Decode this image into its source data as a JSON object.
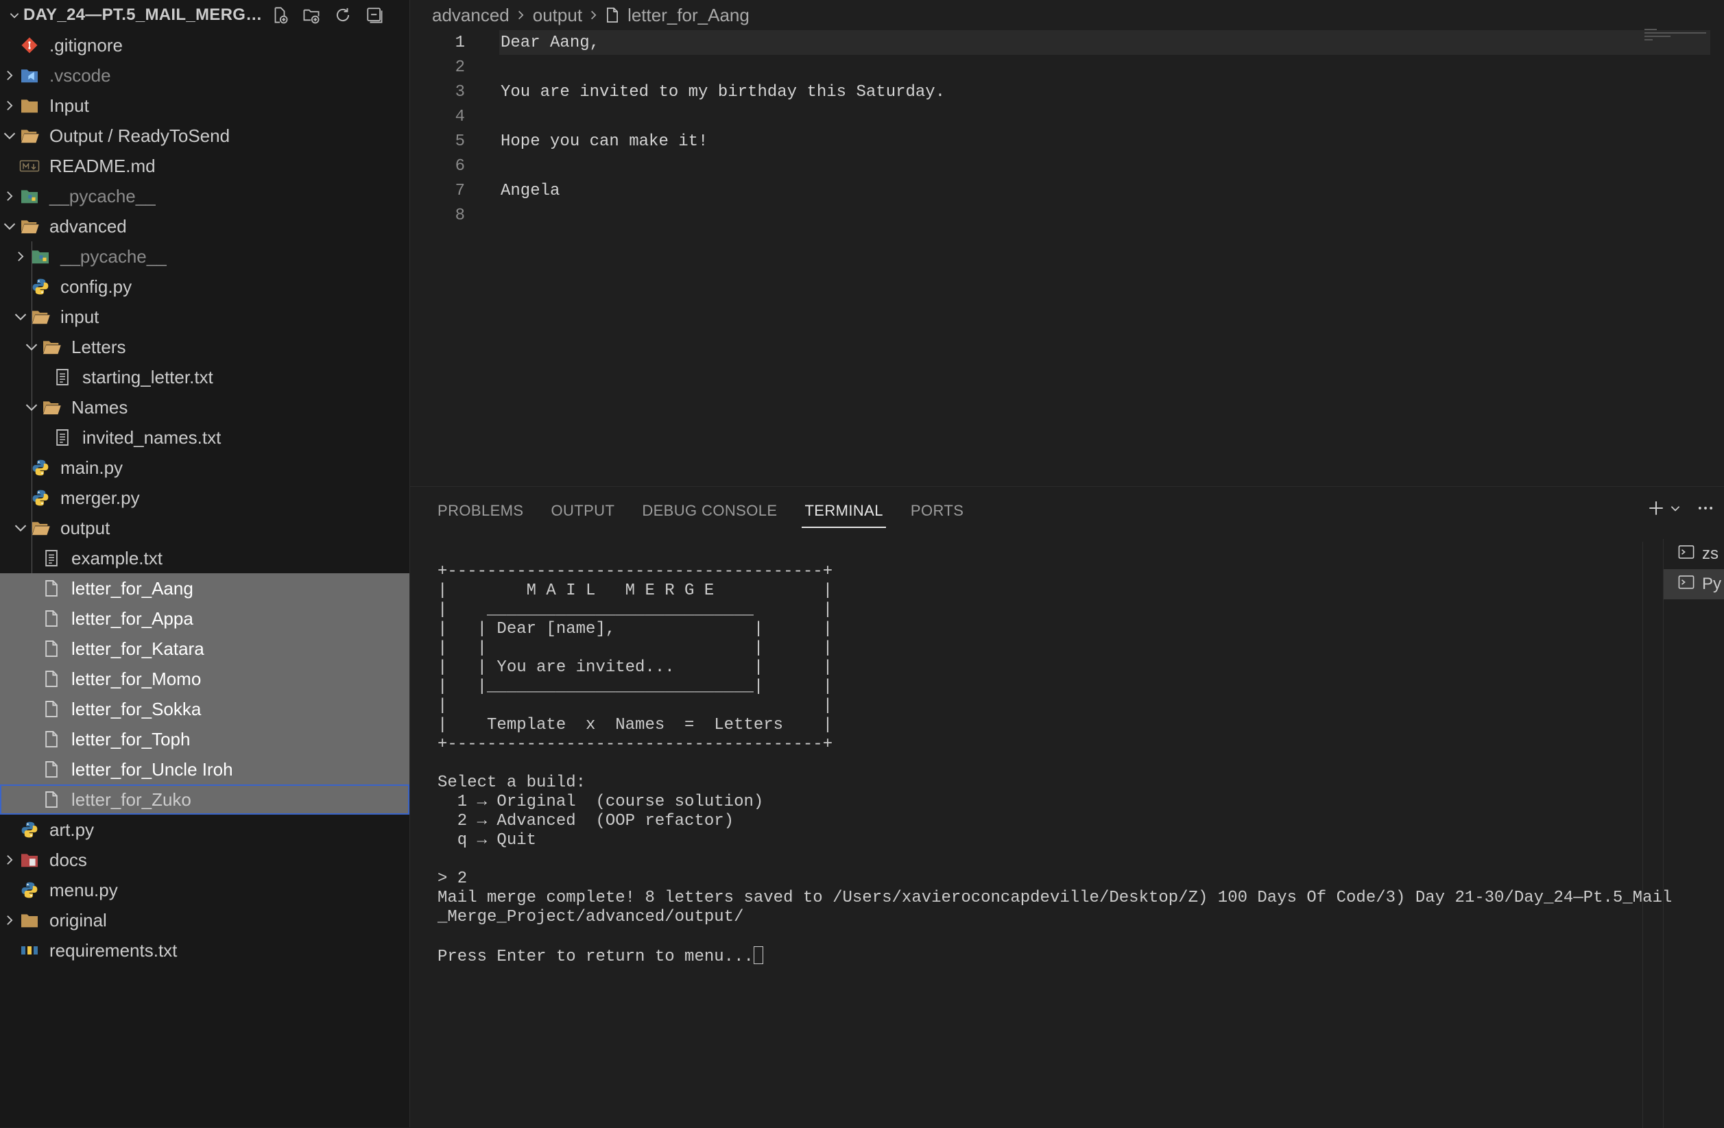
{
  "explorer": {
    "title": "DAY_24—PT.5_MAIL_MERGE...",
    "items": [
      {
        "label": ".gitignore",
        "icon": "git-icon",
        "depth": 0,
        "twistie": "",
        "dim": false,
        "state": ""
      },
      {
        "label": ".vscode",
        "icon": "vscode-folder-icon",
        "depth": 0,
        "twistie": "closed",
        "dim": true,
        "state": ""
      },
      {
        "label": "Input",
        "icon": "folder-icon",
        "depth": 0,
        "twistie": "closed",
        "dim": false,
        "state": ""
      },
      {
        "label": "Output / ReadyToSend",
        "icon": "folder-open-icon",
        "depth": 0,
        "twistie": "open",
        "dim": false,
        "state": ""
      },
      {
        "label": "README.md",
        "icon": "markdown-icon",
        "depth": 0,
        "twistie": "",
        "dim": false,
        "state": ""
      },
      {
        "label": "__pycache__",
        "icon": "python-folder-icon",
        "depth": 0,
        "twistie": "closed",
        "dim": true,
        "state": ""
      },
      {
        "label": "advanced",
        "icon": "folder-open-icon",
        "depth": 0,
        "twistie": "open",
        "dim": false,
        "state": ""
      },
      {
        "label": "__pycache__",
        "icon": "python-folder-icon",
        "depth": 1,
        "twistie": "closed",
        "dim": true,
        "state": ""
      },
      {
        "label": "config.py",
        "icon": "python-icon",
        "depth": 1,
        "twistie": "",
        "dim": false,
        "state": ""
      },
      {
        "label": "input",
        "icon": "folder-open-icon",
        "depth": 1,
        "twistie": "open",
        "dim": false,
        "state": ""
      },
      {
        "label": "Letters",
        "icon": "folder-open-icon",
        "depth": 2,
        "twistie": "open",
        "dim": false,
        "state": ""
      },
      {
        "label": "starting_letter.txt",
        "icon": "text-file-icon",
        "depth": 3,
        "twistie": "",
        "dim": false,
        "state": ""
      },
      {
        "label": "Names",
        "icon": "folder-open-icon",
        "depth": 2,
        "twistie": "open",
        "dim": false,
        "state": ""
      },
      {
        "label": "invited_names.txt",
        "icon": "text-file-icon",
        "depth": 3,
        "twistie": "",
        "dim": false,
        "state": ""
      },
      {
        "label": "main.py",
        "icon": "python-icon",
        "depth": 1,
        "twistie": "",
        "dim": false,
        "state": ""
      },
      {
        "label": "merger.py",
        "icon": "python-icon",
        "depth": 1,
        "twistie": "",
        "dim": false,
        "state": ""
      },
      {
        "label": "output",
        "icon": "folder-open-icon",
        "depth": 1,
        "twistie": "open",
        "dim": false,
        "state": ""
      },
      {
        "label": "example.txt",
        "icon": "text-file-icon",
        "depth": 2,
        "twistie": "",
        "dim": false,
        "state": ""
      },
      {
        "label": "letter_for_Aang",
        "icon": "file-icon",
        "depth": 2,
        "twistie": "",
        "dim": false,
        "state": "selected"
      },
      {
        "label": "letter_for_Appa",
        "icon": "file-icon",
        "depth": 2,
        "twistie": "",
        "dim": false,
        "state": "selected"
      },
      {
        "label": "letter_for_Katara",
        "icon": "file-icon",
        "depth": 2,
        "twistie": "",
        "dim": false,
        "state": "selected"
      },
      {
        "label": "letter_for_Momo",
        "icon": "file-icon",
        "depth": 2,
        "twistie": "",
        "dim": false,
        "state": "selected"
      },
      {
        "label": "letter_for_Sokka",
        "icon": "file-icon",
        "depth": 2,
        "twistie": "",
        "dim": false,
        "state": "selected"
      },
      {
        "label": "letter_for_Toph",
        "icon": "file-icon",
        "depth": 2,
        "twistie": "",
        "dim": false,
        "state": "selected"
      },
      {
        "label": "letter_for_Uncle Iroh",
        "icon": "file-icon",
        "depth": 2,
        "twistie": "",
        "dim": false,
        "state": "selected"
      },
      {
        "label": "letter_for_Zuko",
        "icon": "file-icon",
        "depth": 2,
        "twistie": "",
        "dim": false,
        "state": "focused"
      },
      {
        "label": "art.py",
        "icon": "python-icon",
        "depth": 0,
        "twistie": "",
        "dim": false,
        "state": ""
      },
      {
        "label": "docs",
        "icon": "docs-folder-icon",
        "depth": 0,
        "twistie": "closed",
        "dim": false,
        "state": ""
      },
      {
        "label": "menu.py",
        "icon": "python-icon",
        "depth": 0,
        "twistie": "",
        "dim": false,
        "state": ""
      },
      {
        "label": "original",
        "icon": "folder-icon",
        "depth": 0,
        "twistie": "closed",
        "dim": false,
        "state": ""
      },
      {
        "label": "requirements.txt",
        "icon": "pip-requirements-icon",
        "depth": 0,
        "twistie": "",
        "dim": false,
        "state": ""
      }
    ]
  },
  "breadcrumb": {
    "parts": [
      "advanced",
      "output",
      "letter_for_Aang"
    ]
  },
  "editor": {
    "active_line": 1,
    "lines": [
      {
        "n": "1",
        "text": "Dear Aang,"
      },
      {
        "n": "2",
        "text": ""
      },
      {
        "n": "3",
        "text": "You are invited to my birthday this Saturday."
      },
      {
        "n": "4",
        "text": ""
      },
      {
        "n": "5",
        "text": "Hope you can make it!"
      },
      {
        "n": "6",
        "text": ""
      },
      {
        "n": "7",
        "text": "Angela"
      },
      {
        "n": "8",
        "text": ""
      }
    ]
  },
  "panel": {
    "tabs": [
      "PROBLEMS",
      "OUTPUT",
      "DEBUG CONSOLE",
      "TERMINAL",
      "PORTS"
    ],
    "active_tab": "TERMINAL",
    "terminal_list": [
      "zs",
      "Py"
    ],
    "terminal_text": "+--------------------------------------+\n|        M A I L   M E R G E           |\n|    ___________________________       |\n|   | Dear [name],              |      |\n|   |                           |      |\n|   | You are invited...        |      |\n|   |___________________________|      |\n|                                      |\n|    Template  x  Names  =  Letters    |\n+--------------------------------------+\n\nSelect a build:\n  1 → Original  (course solution)\n  2 → Advanced  (OOP refactor)\n  q → Quit\n\n> 2\nMail merge complete! 8 letters saved to /Users/xavieroconcapdeville/Desktop/Z) 100 Days Of Code/3) Day 21-30/Day_24—Pt.5_Mail\n_Merge_Project/advanced/output/\n\nPress Enter to return to menu..."
  },
  "colors": {
    "sidebar_bg": "#181818",
    "editor_bg": "#1f1f1f",
    "selection_bg": "#6b6b6b",
    "focus_border": "#3a64c9",
    "folder": "#c09553",
    "python_blue": "#3b77a8",
    "python_yellow": "#f2c744",
    "git_red": "#e04e39"
  }
}
